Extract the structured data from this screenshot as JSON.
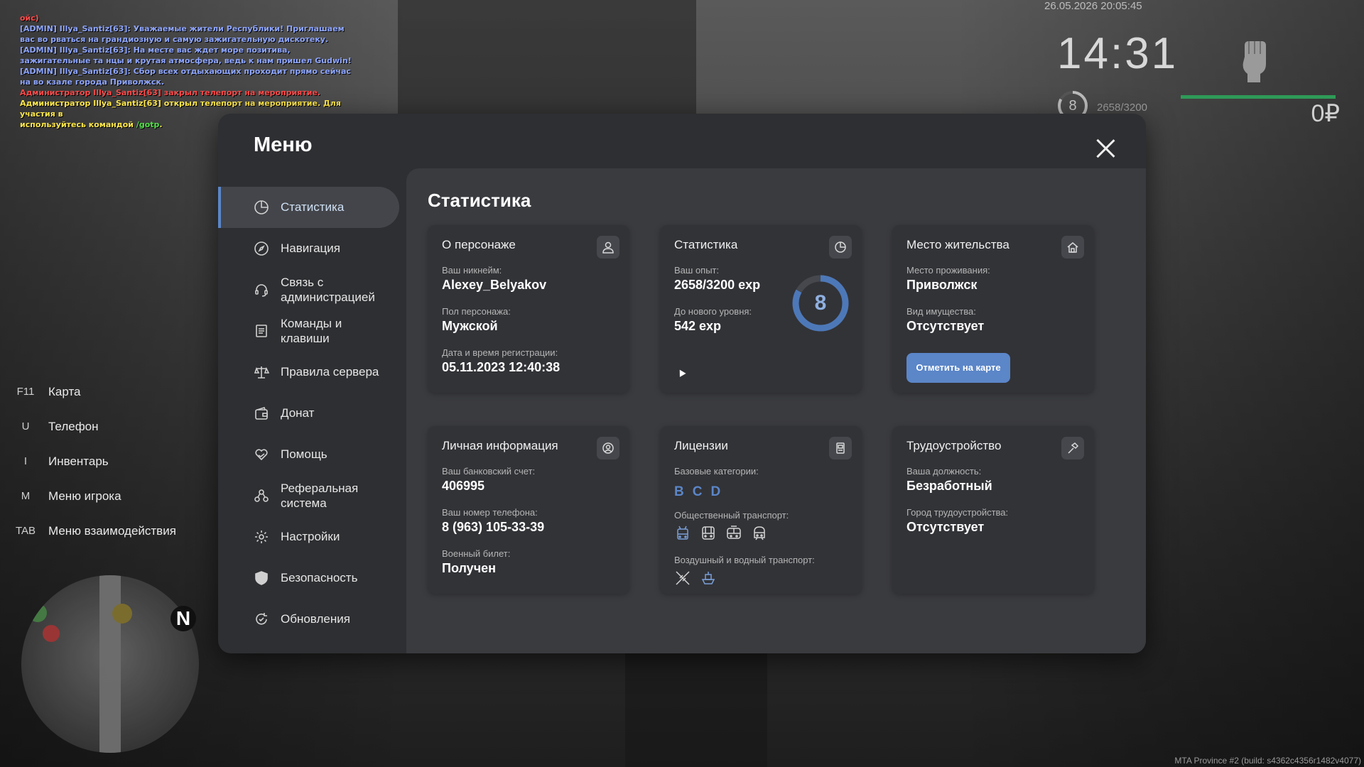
{
  "chat": [
    {
      "text": "ойс)",
      "color": "#ff4b4b"
    },
    {
      "text": "[ADMIN] Illya_Santiz[63]: Уважаемые жители Республики! Приглашаем вас во рваться на грандиозную и самую зажигательную дискотеку.",
      "color": "#8fa6ff"
    },
    {
      "text": "[ADMIN] Illya_Santiz[63]: На месте вас ждет море позитива, зажигательные та нцы и крутая атмосфера, ведь к нам пришел Gudwin!",
      "color": "#8fa6ff"
    },
    {
      "text": "[ADMIN] Illya_Santiz[63]: Сбор всех отдыхающих проходит прямо сейчас на во кзале города Приволжск.",
      "color": "#8fa6ff"
    },
    {
      "text": "Администратор Illya_Santiz[63] закрыл телепорт на мероприятие.",
      "color": "#ff4b4b"
    },
    {
      "text": "Администратор Illya_Santiz[63] открыл телепорт на мероприятие. Для участия в",
      "color": "#ffe84a"
    },
    {
      "text": "используйтесь командой /gotp.",
      "color": "#ffe84a",
      "cmd": "/gotp",
      "cmd_color": "#54e04a"
    }
  ],
  "hud": {
    "datetime": "26.05.2026 20:05:45",
    "time": "14:31",
    "level": "8",
    "exp": "2658/3200",
    "exp_fraction": 0.83,
    "bar_fraction": 1.0,
    "money": "0₽",
    "fist_icon": "fist-icon"
  },
  "hotkeys": [
    {
      "key": "F11",
      "label": "Карта"
    },
    {
      "key": "U",
      "label": "Телефон"
    },
    {
      "key": "I",
      "label": "Инвентарь"
    },
    {
      "key": "M",
      "label": "Меню игрока"
    },
    {
      "key": "TAB",
      "label": "Меню взаимодействия"
    }
  ],
  "minimap": {
    "north_label": "N"
  },
  "menu": {
    "title": "Меню",
    "nav": [
      {
        "label": "Статистика",
        "icon": "pie-chart-icon",
        "active": true
      },
      {
        "label": "Навигация",
        "icon": "compass-icon"
      },
      {
        "label": "Связь с администрацией",
        "icon": "headset-icon"
      },
      {
        "label": "Команды и клавиши",
        "icon": "list-icon"
      },
      {
        "label": "Правила сервера",
        "icon": "scales-icon"
      },
      {
        "label": "Донат",
        "icon": "wallet-icon"
      },
      {
        "label": "Помощь",
        "icon": "heart-hand-icon"
      },
      {
        "label": "Реферальная система",
        "icon": "referral-icon"
      },
      {
        "label": "Настройки",
        "icon": "gear-icon"
      },
      {
        "label": "Безопасность",
        "icon": "shield-icon"
      },
      {
        "label": "Обновления",
        "icon": "refresh-icon"
      }
    ]
  },
  "stats": {
    "title": "Статистика",
    "character": {
      "title": "О персонаже",
      "icon": "user-icon",
      "nickname_label": "Ваш никнейм:",
      "nickname": "Alexey_Belyakov",
      "gender_label": "Пол персонажа:",
      "gender": "Мужской",
      "reg_label": "Дата и время регистрации:",
      "reg": "05.11.2023 12:40:38"
    },
    "statistics": {
      "title": "Статистика",
      "icon": "pie-chart-icon",
      "exp_label": "Ваш опыт:",
      "exp": "2658/3200 exp",
      "next_label": "До нового уровня:",
      "next": "542 exp",
      "level": "8",
      "level_fraction": 0.83
    },
    "residence": {
      "title": "Место жительства",
      "icon": "house-icon",
      "place_label": "Место проживания:",
      "place": "Приволжск",
      "property_label": "Вид имущества:",
      "property": "Отсутствует",
      "button": "Отметить на карте"
    },
    "personal": {
      "title": "Личная информация",
      "icon": "id-icon",
      "bank_label": "Ваш банковский счет:",
      "bank": "406995",
      "phone_label": "Ваш номер телефона:",
      "phone": "8 (963) 105-33-39",
      "military_label": "Военный билет:",
      "military": "Получен"
    },
    "licenses": {
      "title": "Лицензии",
      "icon": "license-icon",
      "base_label": "Базовые категории:",
      "base": [
        "B",
        "C",
        "D"
      ],
      "public_label": "Общественный транспорт:",
      "public": [
        "trolleybus-icon",
        "bus-icon",
        "tram-icon",
        "metro-icon"
      ],
      "air_label": "Воздушный и водный транспорт:",
      "air": [
        "plane-icon",
        "boat-icon"
      ]
    },
    "job": {
      "title": "Трудоустройство",
      "icon": "hammer-icon",
      "position_label": "Ваша должность:",
      "position": "Безработный",
      "city_label": "Город трудоустройства:",
      "city": "Отсутствует"
    }
  },
  "colors": {
    "accent": "#5b86c8",
    "modal_bg": "#2e2f32",
    "content_bg": "#3a3b3f",
    "card_bg": "#323337"
  },
  "build": "MTA Province #2 (build: s4362c4356r1482v4077)"
}
